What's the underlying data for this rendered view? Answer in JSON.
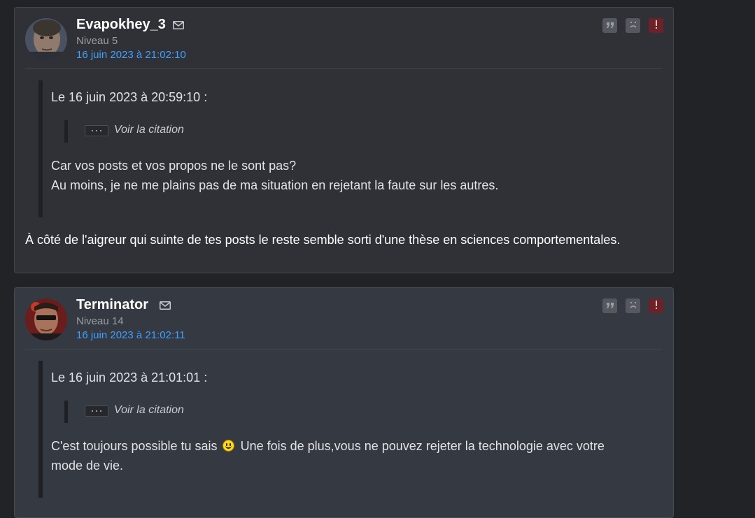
{
  "posts": [
    {
      "author": "Evapokhey_3",
      "level": "Niveau 5",
      "date": "16 juin 2023 à 21:02:10",
      "quote": {
        "header": "Le 16 juin 2023 à 20:59:10 :",
        "see_quote": "Voir la citation",
        "lines": [
          "Car vos posts et vos propos ne le sont pas?",
          "Au moins, je ne me plains pas de ma situation en rejetant la faute sur les autres."
        ]
      },
      "reply": "À côté de l'aigreur qui suinte de tes posts le reste semble sorti d'une thèse en sciences comportementales."
    },
    {
      "author": "Terminator",
      "level": "Niveau 14",
      "date": "16 juin 2023 à 21:02:11",
      "quote": {
        "header": "Le 16 juin 2023 à 21:01:01 :",
        "see_quote": "Voir la citation",
        "text_before_smiley": "C'est toujours possible tu sais",
        "text_after_smiley": "Une fois de plus,vous ne pouvez rejeter la technologie avec votre",
        "text_line2": "mode de vie."
      }
    }
  ],
  "icons": {
    "mail": "mail-icon",
    "quote": "quote-icon",
    "sad": "sad-face-icon",
    "alert": "alert-icon",
    "smiley": "smiley-icon"
  },
  "colors": {
    "date_link": "#3fa0ff",
    "alert_button": "#6b2329"
  }
}
